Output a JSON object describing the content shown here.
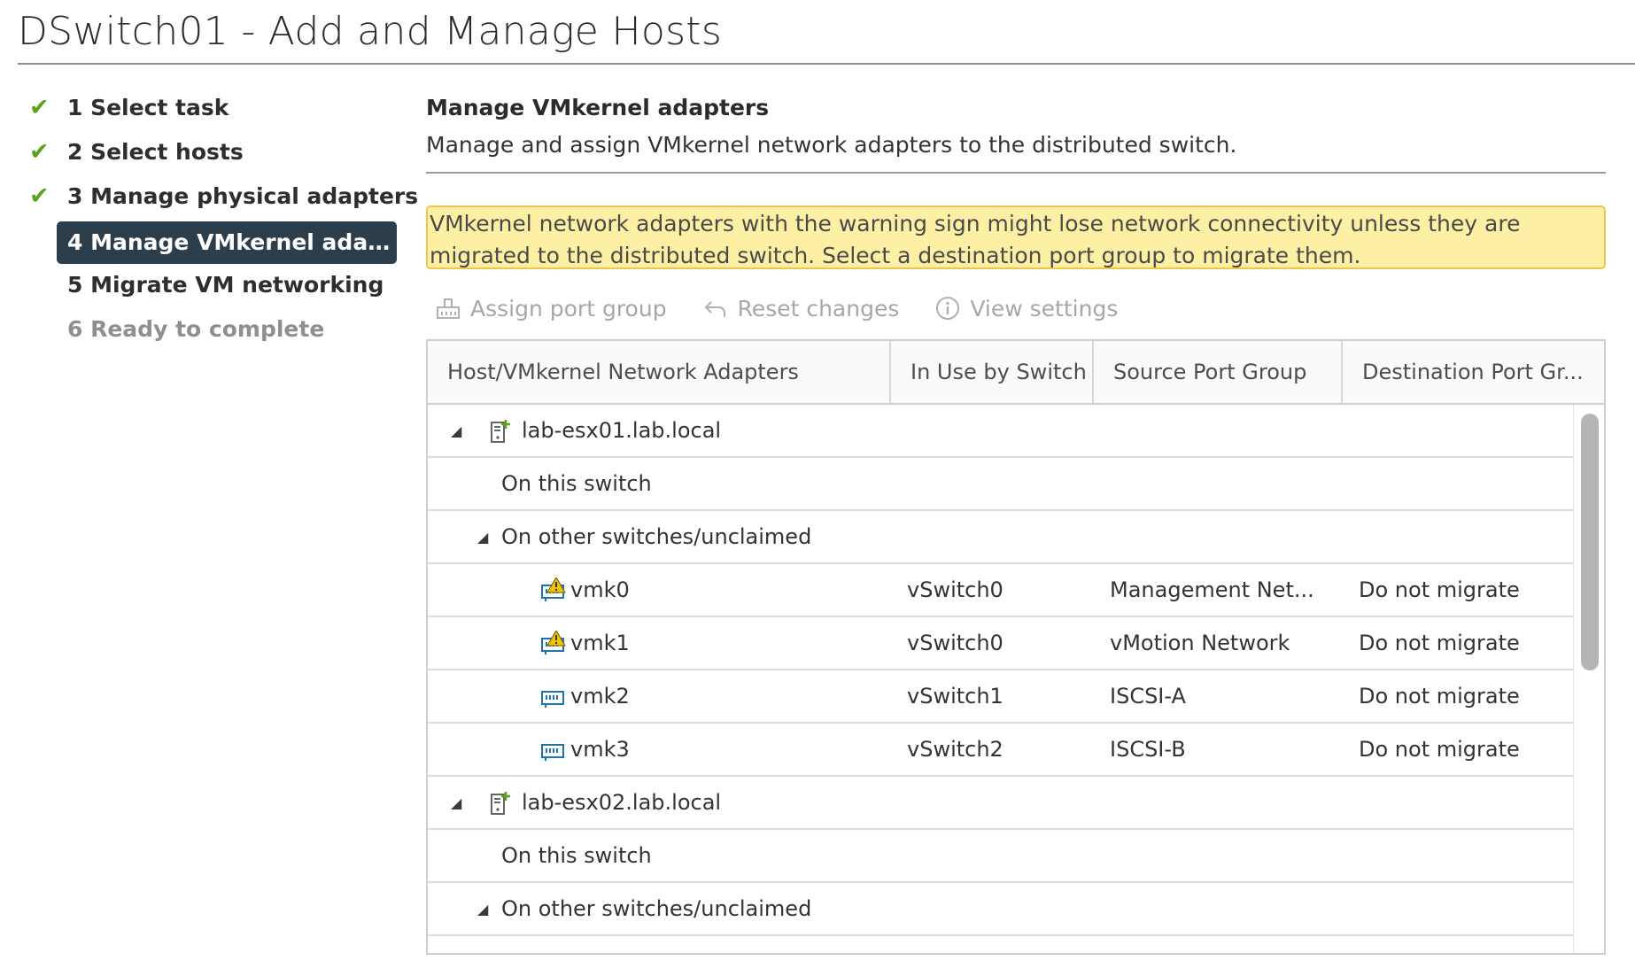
{
  "window": {
    "title": "DSwitch01 - Add and Manage Hosts"
  },
  "steps": [
    {
      "label": "1 Select task",
      "state": "done"
    },
    {
      "label": "2 Select hosts",
      "state": "done"
    },
    {
      "label": "3 Manage physical adapters",
      "state": "done"
    },
    {
      "label": "4 Manage VMkernel adapt...",
      "state": "active"
    },
    {
      "label": "5 Migrate VM networking",
      "state": "pending"
    },
    {
      "label": "6 Ready to complete",
      "state": "disabled"
    }
  ],
  "section": {
    "title": "Manage VMkernel adapters",
    "description": "Manage and assign VMkernel network adapters to the distributed switch."
  },
  "warning": {
    "line1": "VMkernel network adapters with the warning sign might lose network connectivity unless they are",
    "line2": "migrated to the distributed switch. Select a destination port group to migrate them."
  },
  "toolbar": {
    "assign_label": "Assign port group",
    "reset_label": "Reset changes",
    "view_label": "View settings"
  },
  "grid": {
    "columns": [
      "Host/VMkernel Network Adapters",
      "In Use by Switch",
      "Source Port Group",
      "Destination Port Gr..."
    ],
    "rows": [
      {
        "type": "host",
        "label": "lab-esx01.lab.local",
        "expanded": true
      },
      {
        "type": "group",
        "label": "On this switch",
        "expanded": false
      },
      {
        "type": "group",
        "label": "On other switches/unclaimed",
        "expanded": true
      },
      {
        "type": "vmk",
        "label": "vmk0",
        "warning": true,
        "switch": "vSwitch0",
        "source": "Management Net...",
        "dest": "Do not migrate"
      },
      {
        "type": "vmk",
        "label": "vmk1",
        "warning": true,
        "switch": "vSwitch0",
        "source": "vMotion Network",
        "dest": "Do not migrate"
      },
      {
        "type": "vmk",
        "label": "vmk2",
        "warning": false,
        "switch": "vSwitch1",
        "source": "ISCSI-A",
        "dest": "Do not migrate"
      },
      {
        "type": "vmk",
        "label": "vmk3",
        "warning": false,
        "switch": "vSwitch2",
        "source": "ISCSI-B",
        "dest": "Do not migrate"
      },
      {
        "type": "host",
        "label": "lab-esx02.lab.local",
        "expanded": true
      },
      {
        "type": "group",
        "label": "On this switch",
        "expanded": false
      },
      {
        "type": "group",
        "label": "On other switches/unclaimed",
        "expanded": true
      }
    ]
  },
  "colors": {
    "check": "#5aa220",
    "active_step_bg": "#2c3e4c",
    "warning_bg": "#fdf0a5",
    "warning_border": "#efc54c",
    "adapter_icon": "#1b75bb",
    "warning_icon": "#f2c500"
  }
}
